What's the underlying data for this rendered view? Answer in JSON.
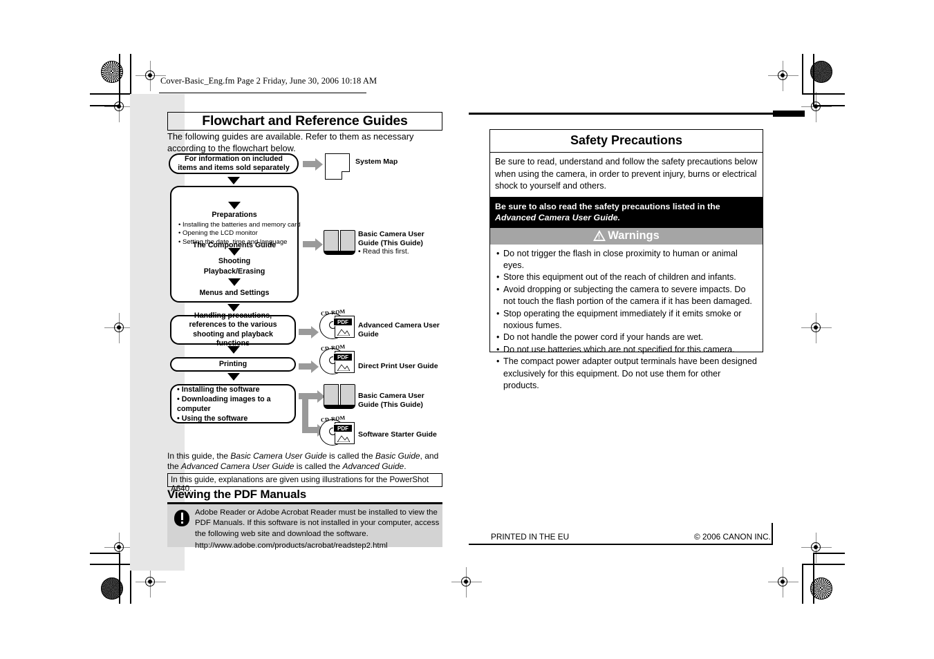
{
  "page": {
    "header_line": "Cover-Basic_Eng.fm  Page 2  Friday, June 30, 2006  10:18 AM"
  },
  "left": {
    "title": "Flowchart and Reference Guides",
    "intro": "The following guides are available. Refer to them as necessary according to the flowchart below.",
    "flow": {
      "n1": "For information on included items and items sold separately",
      "n2_heading": "The Components Guide",
      "n2_prep_heading": "Preparations",
      "n2_prep_items": [
        "Installing the batteries and memory card",
        "Opening the LCD monitor",
        "Setting the date, time and language"
      ],
      "n2_shooting": "Shooting",
      "n2_playback": "Playback/Erasing",
      "n2_menus": "Menus and Settings",
      "n3": "Handling precautions, references to the various shooting and playback functions",
      "n4": "Printing",
      "n5_items": [
        "Installing the software",
        "Downloading images to a computer",
        "Using the software"
      ]
    },
    "targets": {
      "system_map": "System Map",
      "basic_guide_1_l1": "Basic Camera User",
      "basic_guide_1_l2": "Guide (This Guide)",
      "basic_guide_1_note": "• Read this first.",
      "advanced_l1": "Advanced Camera User",
      "advanced_l2": "Guide",
      "direct_print": "Direct Print User Guide",
      "basic_guide_2_l1": "Basic Camera User",
      "basic_guide_2_l2": "Guide (This Guide)",
      "software_starter": "Software Starter Guide",
      "cd_label": "CD-ROM",
      "pdf_label": "PDF"
    },
    "naming_note_line1_a": "In this guide, the ",
    "naming_note_line1_b": "Basic Camera User Guide",
    "naming_note_line1_c": " is called the ",
    "naming_note_line1_d": "Basic Guide",
    "naming_note_line1_e": ", and",
    "naming_note_line2_a": "the ",
    "naming_note_line2_b": "Advanced Camera User Guide",
    "naming_note_line2_c": " is called the ",
    "naming_note_line2_d": "Advanced Guide",
    "naming_note_line2_e": ".",
    "illustration_note": "In this guide, explanations are given using illustrations for the PowerShot A640.",
    "pdf_heading": "Viewing the PDF Manuals",
    "pdf_note": "Adobe Reader or Adobe Acrobat Reader must be installed to view the PDF Manuals. If this software is not installed in your computer, access the following web site and download the software.",
    "pdf_url": "http://www.adobe.com/products/acrobat/readstep2.html"
  },
  "right": {
    "title": "Safety Precautions",
    "lead": "Be sure to read, understand and follow the safety precautions below when using the camera, in order to prevent injury, burns or electrical shock to yourself and others.",
    "also_read_1": "Be sure to also read the safety precautions listed in the",
    "also_read_2": "Advanced Camera User Guide.",
    "warnings_label": "Warnings",
    "warnings": [
      "Do not trigger the flash in close proximity to human or animal eyes.",
      "Store this equipment out of the reach of children and infants.",
      "Avoid dropping or subjecting the camera to severe impacts. Do not touch the flash portion of the camera if it has been damaged.",
      "Stop operating the equipment immediately if it emits smoke or noxious fumes.",
      "Do not handle the power cord if your hands are wet.",
      "Do not use batteries which are not specified for this camera.",
      "The compact power adapter output terminals have been designed exclusively for this equipment. Do not use them for other products."
    ]
  },
  "footer": {
    "printed": "PRINTED IN THE EU",
    "copyright": "© 2006 CANON INC."
  }
}
